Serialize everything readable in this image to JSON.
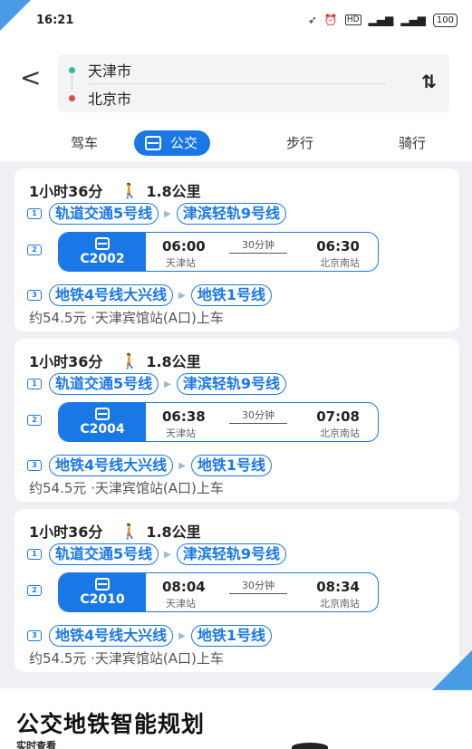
{
  "status_bar": {
    "time": "16:21",
    "icons": [
      "location-arrow-icon",
      "alarm-icon",
      "hd-icon",
      "signal-4g-icon",
      "signal-icon"
    ],
    "battery": "100"
  },
  "route": {
    "from": "天津市",
    "to": "北京市"
  },
  "modes": {
    "drive": "驾车",
    "transit": "公交",
    "walk": "步行",
    "ride": "骑行"
  },
  "plans": [
    {
      "duration": "1小时36分",
      "walk": "1.8公里",
      "step1": [
        "轨道交通5号线",
        "津滨轻轨9号线"
      ],
      "train": {
        "code": "C2002",
        "dep_time": "06:00",
        "dep_station": "天津站",
        "duration": "30分钟",
        "arr_time": "06:30",
        "arr_station": "北京南站"
      },
      "step3": [
        "地铁4号线大兴线",
        "地铁1号线"
      ],
      "fare": "约54.5元 ·天津宾馆站(A口)上车"
    },
    {
      "duration": "1小时36分",
      "walk": "1.8公里",
      "step1": [
        "轨道交通5号线",
        "津滨轻轨9号线"
      ],
      "train": {
        "code": "C2004",
        "dep_time": "06:38",
        "dep_station": "天津站",
        "duration": "30分钟",
        "arr_time": "07:08",
        "arr_station": "北京南站"
      },
      "step3": [
        "地铁4号线大兴线",
        "地铁1号线"
      ],
      "fare": "约54.5元 ·天津宾馆站(A口)上车"
    },
    {
      "duration": "1小时36分",
      "walk": "1.8公里",
      "step1": [
        "轨道交通5号线",
        "津滨轻轨9号线"
      ],
      "train": {
        "code": "C2010",
        "dep_time": "08:04",
        "dep_station": "天津站",
        "duration": "30分钟",
        "arr_time": "08:34",
        "arr_station": "北京南站"
      },
      "step3": [
        "地铁4号线大兴线",
        "地铁1号线"
      ],
      "fare": "约54.5元 ·天津宾馆站(A口)上车"
    }
  ],
  "step_numbers": [
    "1",
    "2",
    "3"
  ],
  "promo": {
    "title": "公交地铁智能规划",
    "subtitle": "实时查看"
  },
  "colors": {
    "accent": "#1a78e6",
    "corner": "#4a9be6"
  }
}
